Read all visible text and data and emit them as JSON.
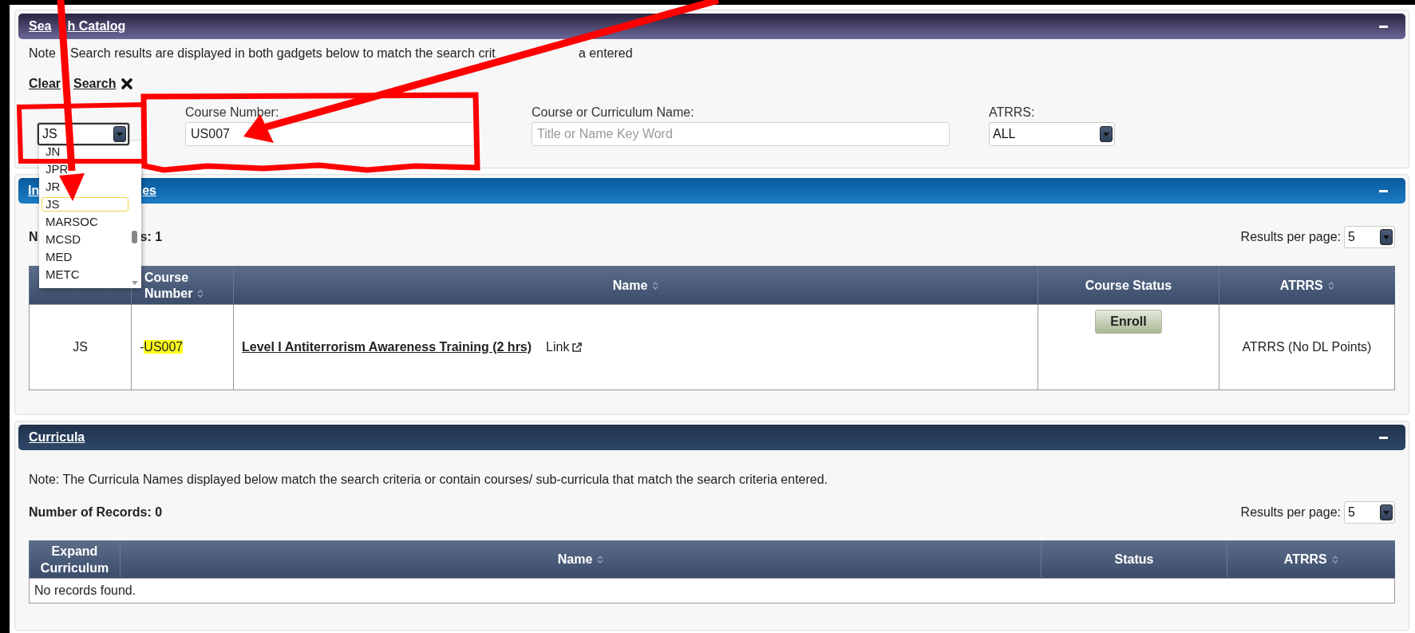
{
  "search_panel": {
    "title_parts": [
      "Sea",
      "h Catalog"
    ],
    "note_parts": [
      "Note",
      "Search results are displayed in both gadgets below to match the search crit",
      "a entered"
    ],
    "clear_parts": [
      "Clear",
      "Search"
    ],
    "fields": [
      {
        "kind": "select",
        "value": "JS",
        "open": true
      },
      {
        "kind": "text",
        "label": "Course Number:",
        "value": "US007"
      },
      {
        "kind": "text",
        "label": "Course or Curriculum Name:",
        "placeholder": "Title or Name Key Word"
      },
      {
        "kind": "select",
        "label": "ATRRS:",
        "value": "ALL",
        "open": false
      }
    ],
    "prefix_options": [
      {
        "label": "JN",
        "selected": false
      },
      {
        "label": "JPR",
        "selected": false
      },
      {
        "label": "JR",
        "selected": false
      },
      {
        "label": "JS",
        "selected": true
      },
      {
        "label": "MARSOC",
        "selected": false
      },
      {
        "label": "MCSD",
        "selected": false
      },
      {
        "label": "MED",
        "selected": false
      },
      {
        "label": "METC",
        "selected": false
      }
    ]
  },
  "courses_panel": {
    "title_parts": [
      "In",
      "es"
    ],
    "records_parts": [
      "N",
      "s: 1"
    ],
    "results_label": "Results per page:",
    "results_value": "5",
    "columns": [
      {
        "sortable": false
      },
      {
        "label": "Course Number",
        "sortable": true
      },
      {
        "label": "Name",
        "sortable": true
      },
      {
        "label": "Course Status",
        "sortable": false
      },
      {
        "label": "ATRRS",
        "sortable": true
      }
    ],
    "rows": [
      {
        "prefix": "JS",
        "number_prefix": "-",
        "number": "US007",
        "number_highlighted": true,
        "name": "Level I Antiterrorism Awareness Training (2 hrs)",
        "link": "Link",
        "status_button": "Enroll",
        "atrrs": "ATRRS (No DL Points)"
      }
    ]
  },
  "curricula_panel": {
    "title": "Curricula",
    "note": "Note: The Curricula Names displayed below match the search criteria or contain courses/ sub-curricula that match the search criteria entered.",
    "records": "Number of Records: 0",
    "results_label": "Results per page:",
    "results_value": "5",
    "columns": [
      {
        "label": "Expand Curriculum",
        "sortable": false
      },
      {
        "label": "Name",
        "sortable": true
      },
      {
        "label": "Status",
        "sortable": false
      },
      {
        "label": "ATRRS",
        "sortable": true
      }
    ],
    "empty": "No records found."
  }
}
